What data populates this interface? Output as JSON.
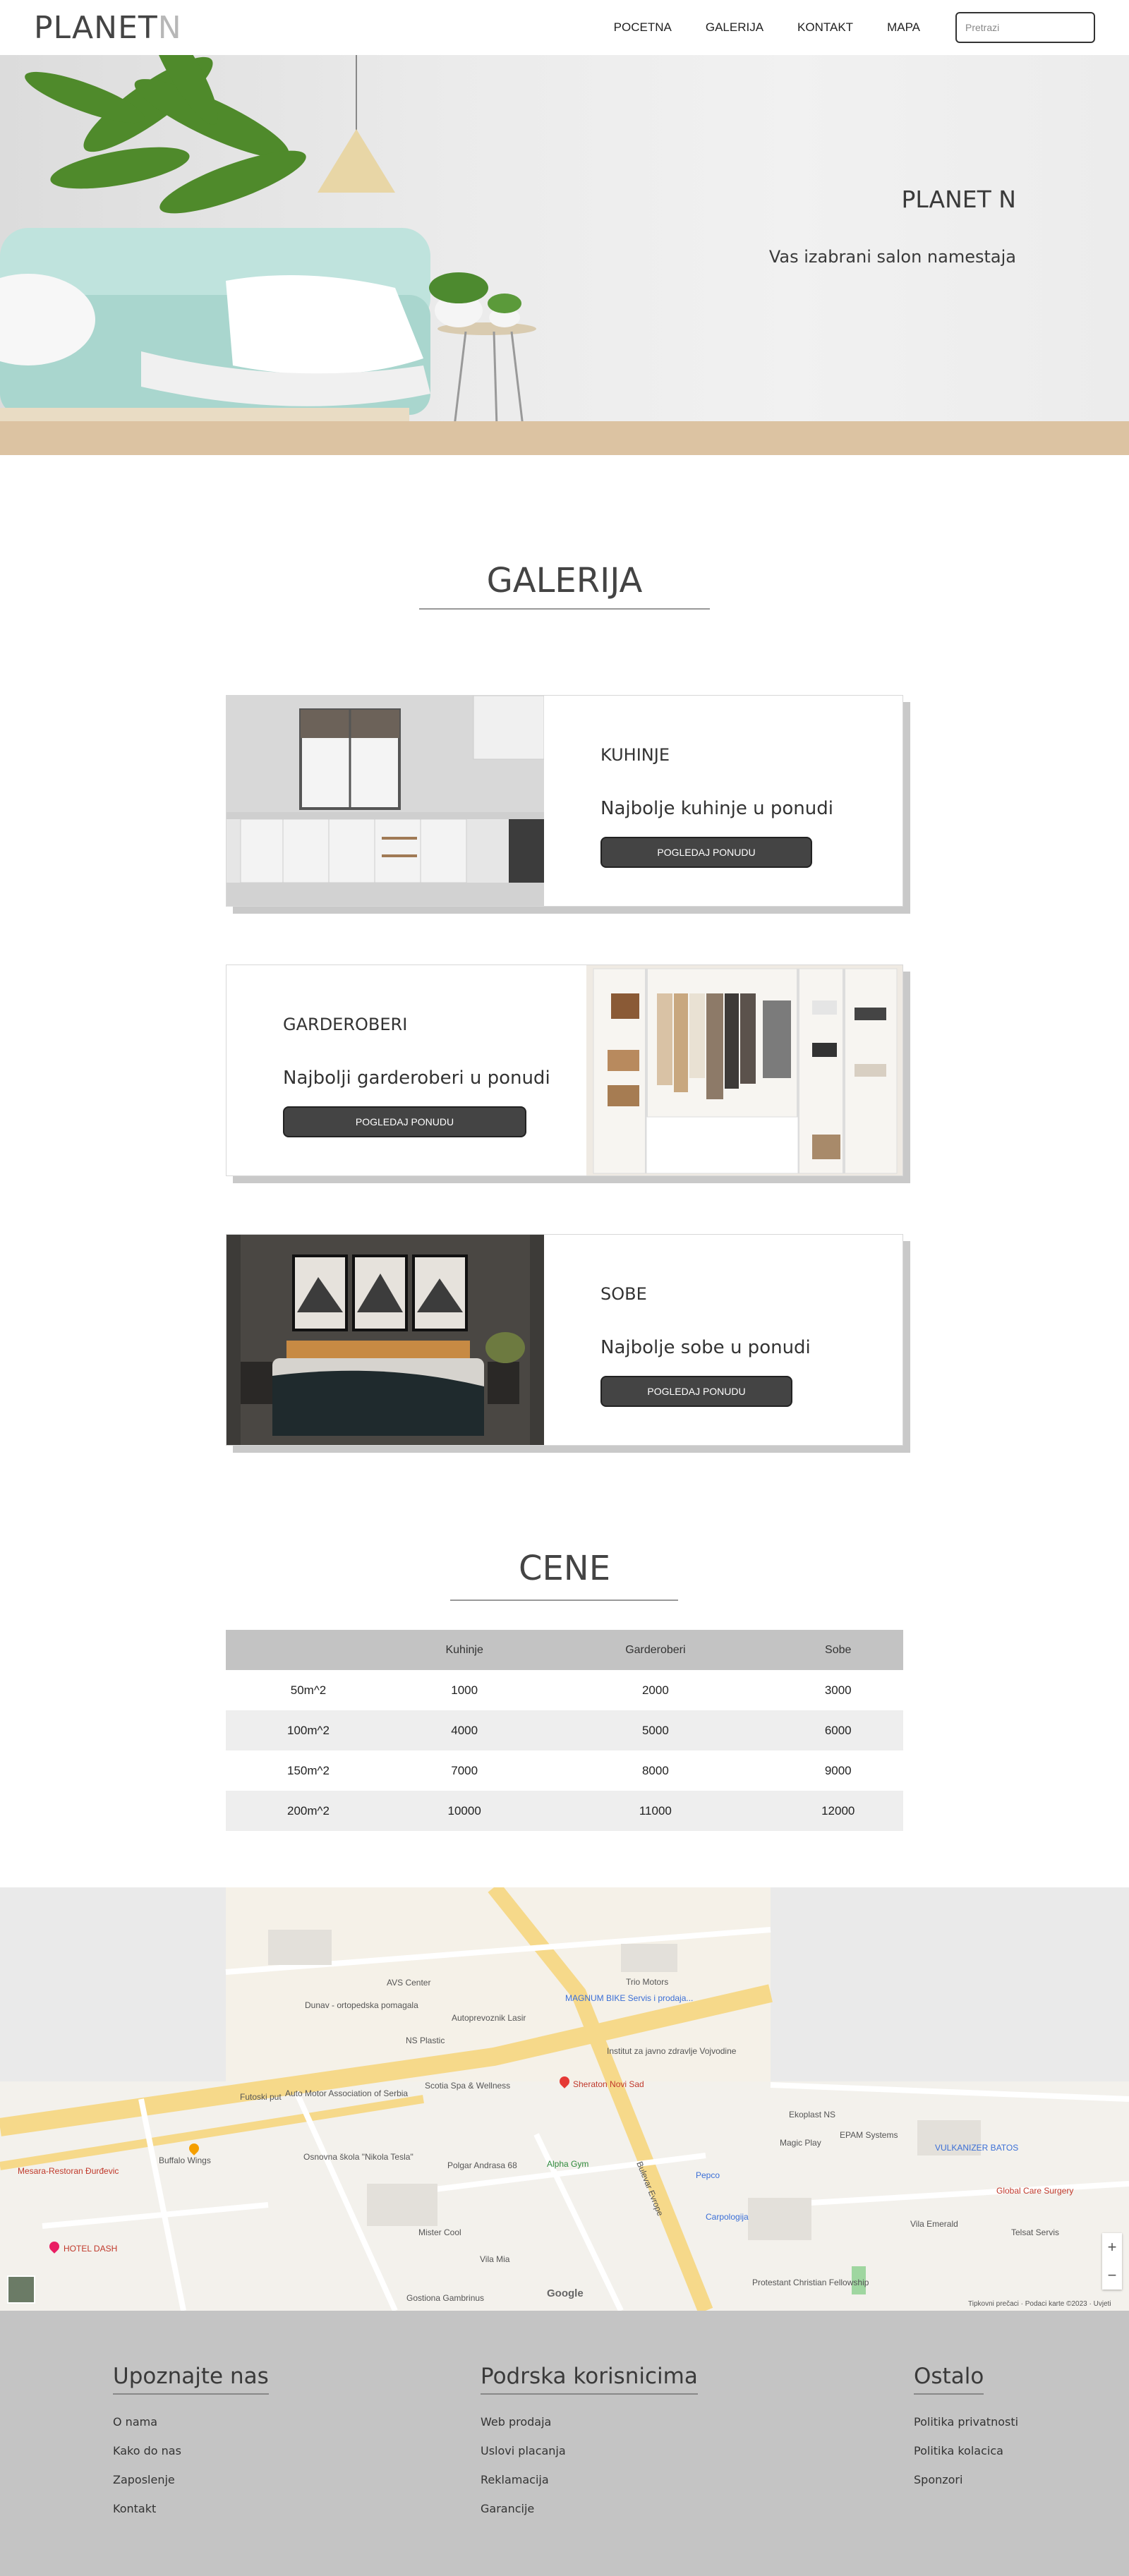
{
  "header": {
    "logo_main": "PLANET",
    "logo_accent": "N",
    "nav": [
      "POCETNA",
      "GALERIJA",
      "KONTAKT",
      "MAPA"
    ],
    "search_placeholder": "Pretrazi"
  },
  "hero": {
    "title": "PLANET N",
    "subtitle": "Vas izabrani salon namestaja"
  },
  "gallery": {
    "title": "GALERIJA",
    "cards": [
      {
        "category": "KUHINJE",
        "description": "Najbolje kuhinje u ponudi",
        "button": "POGLEDAJ PONUDU"
      },
      {
        "category": "GARDEROBERI",
        "description": "Najbolji garderoberi u ponudi",
        "button": "POGLEDAJ PONUDU"
      },
      {
        "category": "SOBE",
        "description": "Najbolje sobe u ponudi",
        "button": "POGLEDAJ PONUDU"
      }
    ]
  },
  "prices": {
    "title": "CENE",
    "headers": [
      "",
      "Kuhinje",
      "Garderoberi",
      "Sobe"
    ],
    "rows": [
      [
        "50m^2",
        "1000",
        "2000",
        "3000"
      ],
      [
        "100m^2",
        "4000",
        "5000",
        "6000"
      ],
      [
        "150m^2",
        "7000",
        "8000",
        "9000"
      ],
      [
        "200m^2",
        "10000",
        "11000",
        "12000"
      ]
    ]
  },
  "map": {
    "labels": {
      "sheraton": "Sheraton Novi Sad",
      "scotia": "Scotia Spa & Wellness",
      "auto_motor": "Auto Motor Association of Serbia",
      "buffalo": "Buffalo Wings",
      "tesla_school": "Osnovna škola \"Nikola Tesla\"",
      "polgar": "Polgar Andrasa 68",
      "alpha_gym": "Alpha Gym",
      "pepco": "Pepco",
      "carpologija": "Carpologija",
      "epam": "EPAM Systems",
      "vulkanizer": "VULKANIZER BATOS",
      "global_care": "Global Care Surgery",
      "magic_play": "Magic Play",
      "vila_emerald": "Vila Emerald",
      "telsat": "Telsat Servis",
      "hotel_dash": "HOTEL DASH",
      "mesara": "Mesara-Restoran Đurđevic",
      "mister_cool": "Mister Cool",
      "vila_mia": "Vila Mia",
      "gostiona": "Gostiona Gambrinus",
      "protestant": "Protestant Christian Fellowship",
      "dunav": "Dunav - ortopedska pomagala",
      "avs": "AVS Center",
      "magnum": "MAGNUM BIKE Servis i prodaja...",
      "trio": "Trio Motors",
      "autoprevoz": "Autoprevoznik Lasir",
      "ns_plastic": "NS Plastic",
      "institut": "Institut za javno zdravlje Vojvodine",
      "futoski_put": "Futoski put",
      "bulevar_evrope": "Bulevar Evrope",
      "ekoplast": "Ekoplast NS",
      "google": "Google",
      "map_footer": "Tipkovni prečaci · Podaci karte ©2023 · Uvjeti"
    },
    "zoom_in": "+",
    "zoom_out": "−"
  },
  "footer": {
    "columns": [
      {
        "title": "Upoznajte nas",
        "items": [
          "O nama",
          "Kako do nas",
          "Zaposlenje",
          "Kontakt"
        ]
      },
      {
        "title": "Podrska korisnicima",
        "items": [
          "Web prodaja",
          "Uslovi placanja",
          "Reklamacija",
          "Garancije"
        ]
      },
      {
        "title": "Ostalo",
        "items": [
          "Politika privatnosti",
          "Politika kolacica",
          "Sponzori"
        ]
      }
    ]
  }
}
